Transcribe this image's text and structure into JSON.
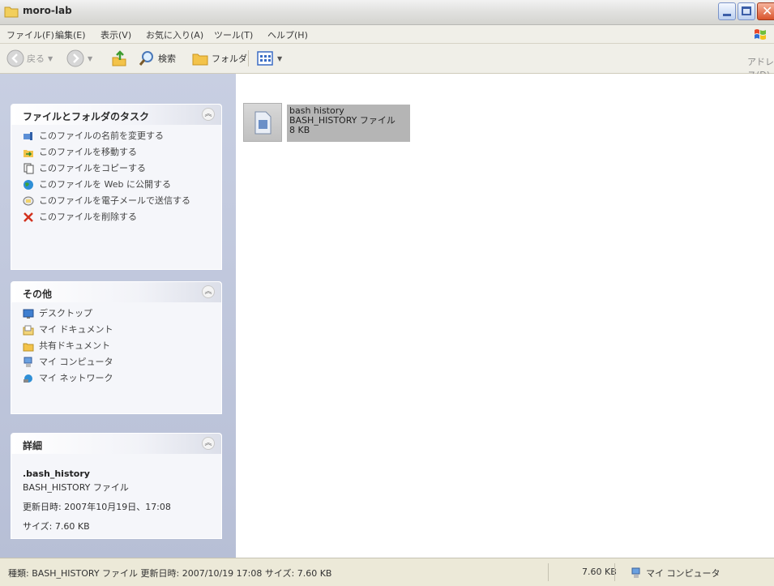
{
  "window": {
    "title": "moro-lab"
  },
  "menu": {
    "items": [
      "ファイル(F)",
      "編集(E)",
      "表示(V)",
      "お気に入り(A)",
      "ツール(T)",
      "ヘルプ(H)"
    ]
  },
  "toolbar": {
    "back_label": "戻る",
    "search_label": "検索",
    "folders_label": "フォルダ",
    "address_label": "アドレス(D)"
  },
  "tasks_panel": {
    "title": "ファイルとフォルダのタスク",
    "items": [
      {
        "label": "このファイルの名前を変更する",
        "icon": "rename-icon"
      },
      {
        "label": "このファイルを移動する",
        "icon": "move-icon"
      },
      {
        "label": "このファイルをコピーする",
        "icon": "copy-icon"
      },
      {
        "label": "このファイルを Web に公開する",
        "icon": "globe-icon"
      },
      {
        "label": "このファイルを電子メールで送信する",
        "icon": "email-icon"
      },
      {
        "label": "このファイルを削除する",
        "icon": "delete-icon"
      }
    ]
  },
  "other_panel": {
    "title": "その他",
    "items": [
      {
        "label": "デスクトップ",
        "icon": "desktop-icon"
      },
      {
        "label": "マイ ドキュメント",
        "icon": "my-documents-icon"
      },
      {
        "label": "共有ドキュメント",
        "icon": "shared-folder-icon"
      },
      {
        "label": "マイ コンピュータ",
        "icon": "my-computer-icon"
      },
      {
        "label": "マイ ネットワーク",
        "icon": "network-icon"
      }
    ]
  },
  "details_panel": {
    "title": "詳細",
    "name": ".bash_history",
    "type": "BASH_HISTORY ファイル",
    "modified": "更新日時: 2007年10月19日、17:08",
    "size": "サイズ: 7.60 KB"
  },
  "file": {
    "name": "bash history",
    "type": "BASH_HISTORY ファイル",
    "size": "8 KB"
  },
  "status": {
    "info": "種類: BASH_HISTORY ファイル 更新日時: 2007/10/19 17:08 サイズ: 7.60 KB",
    "size": "7.60 KB",
    "location": "マイ コンピュータ"
  },
  "colors": {
    "taskpane_bg": "#b7bfd6",
    "selection": "#b5b5b5",
    "close_button": "#d9542c"
  }
}
